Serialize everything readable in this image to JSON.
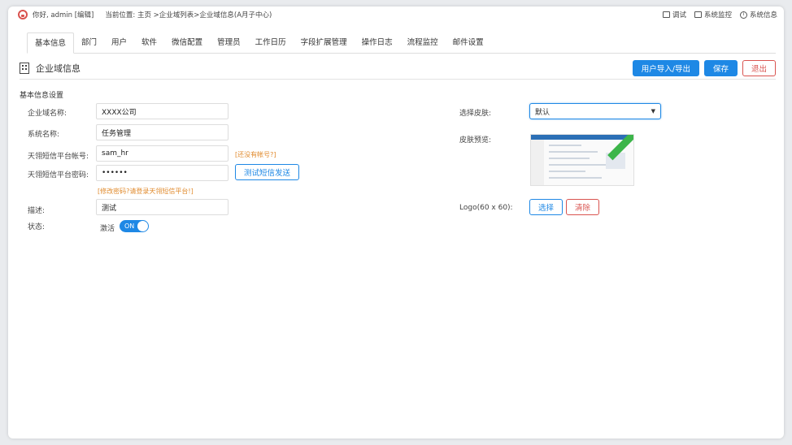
{
  "topbar": {
    "greeting": "你好, admin [编辑]",
    "location": "当前位置: 主页 >企业域列表>企业域信息(A月子中心)",
    "debug": "调试",
    "monitor": "系统监控",
    "info": "系统信息"
  },
  "tabs": [
    {
      "label": "基本信息",
      "active": true
    },
    {
      "label": "部门"
    },
    {
      "label": "用户"
    },
    {
      "label": "软件"
    },
    {
      "label": "微信配置"
    },
    {
      "label": "管理员"
    },
    {
      "label": "工作日历"
    },
    {
      "label": "字段扩展管理"
    },
    {
      "label": "操作日志"
    },
    {
      "label": "流程监控"
    },
    {
      "label": "邮件设置"
    }
  ],
  "header": {
    "title": "企业域信息",
    "import_export": "用户导入/导出",
    "save": "保存",
    "exit": "退出"
  },
  "form": {
    "section_title": "基本信息设置",
    "domain_name_label": "企业域名称:",
    "domain_name_value": "XXXX公司",
    "system_name_label": "系统名称:",
    "system_name_value": "任务管理",
    "sms_account_label": "天翎短信平台帐号:",
    "sms_account_value": "sam_hr",
    "sms_account_hint": "[还没有帐号?]",
    "sms_password_label": "天翎短信平台密码:",
    "sms_password_value": "••••••",
    "test_sms_button": "测试短信发送",
    "password_hint": "[修改密码?请登录天翎短信平台!]",
    "desc_label": "描述:",
    "desc_value": "测试",
    "status_label": "状态:",
    "status_text": "激活",
    "toggle_text": "ON",
    "skin_label": "选择皮肤:",
    "skin_value": "默认",
    "preview_label": "皮肤预览:",
    "logo_label": "Logo(60 x 60):",
    "logo_select": "选择",
    "logo_clear": "清除"
  },
  "colors": {
    "primary": "#1e88e5",
    "danger": "#d9534f",
    "hint": "#e08a2c"
  }
}
